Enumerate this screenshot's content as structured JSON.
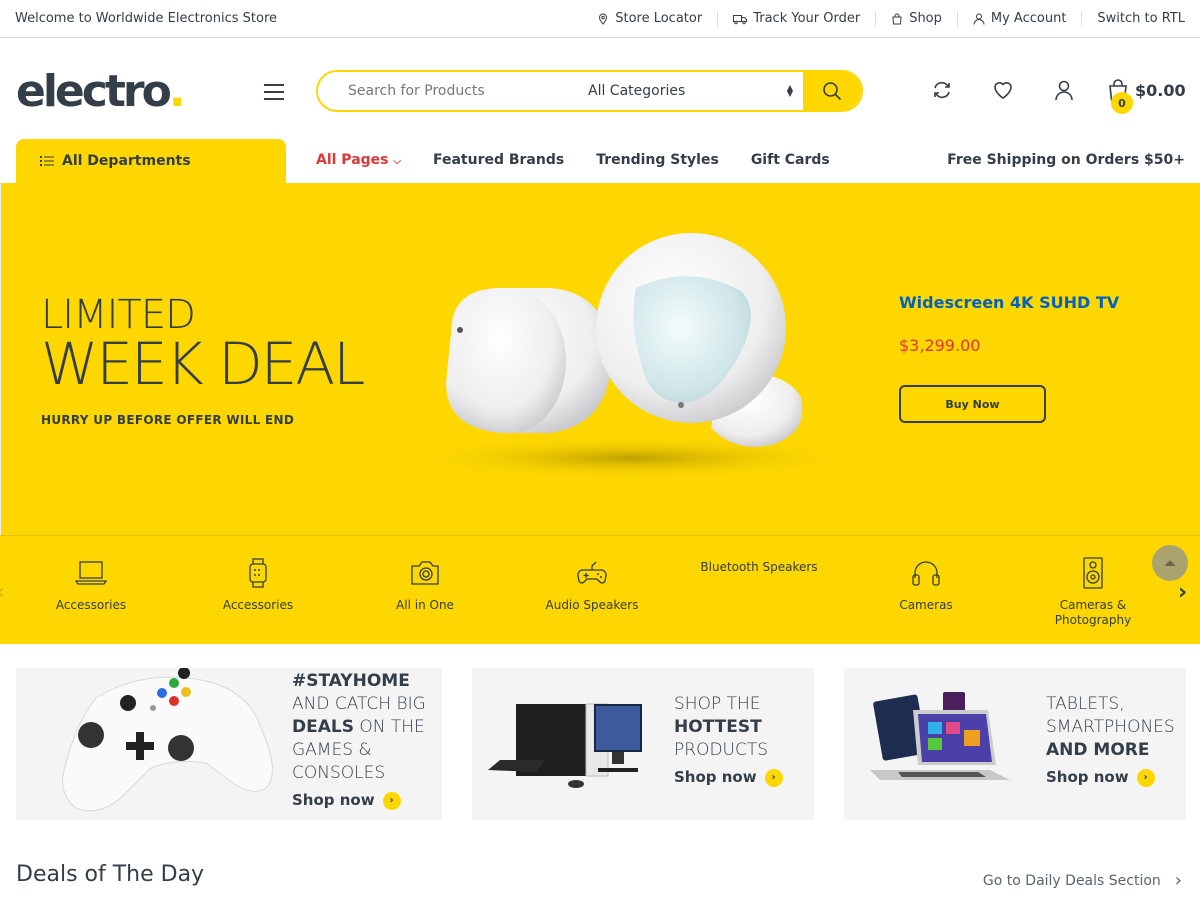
{
  "topbar": {
    "welcome": "Welcome to Worldwide Electronics Store",
    "links": {
      "store_locator": "Store Locator",
      "track_order": "Track Your Order",
      "shop": "Shop",
      "my_account": "My Account",
      "rtl": "Switch to RTL"
    }
  },
  "header": {
    "logo_text": "electro",
    "logo_dot": ".",
    "search_placeholder": "Search for Products",
    "category_selected": "All Categories",
    "cart_count": "0",
    "cart_total": "$0.00"
  },
  "nav": {
    "departments": "All Departments",
    "links": [
      "All Pages",
      "Featured Brands",
      "Trending Styles",
      "Gift Cards"
    ],
    "free_shipping": "Free Shipping on Orders $50+"
  },
  "hero": {
    "line1": "LIMITED",
    "line2": "WEEK DEAL",
    "line3": "HURRY UP BEFORE OFFER WILL END",
    "product_title": "Widescreen 4K SUHD TV",
    "product_price": "$3,299.00",
    "button": "Buy Now"
  },
  "categories": [
    {
      "label": "Accessories",
      "icon": "laptop-icon"
    },
    {
      "label": "Accessories",
      "icon": "smartwatch-icon"
    },
    {
      "label": "All in One",
      "icon": "camera-icon"
    },
    {
      "label": "Audio Speakers",
      "icon": "gamepad-icon"
    },
    {
      "label": "Bluetooth Speakers",
      "icon": ""
    },
    {
      "label": "Cameras",
      "icon": "headphones-icon"
    },
    {
      "label": "Cameras & Photography",
      "icon": "speaker-icon"
    }
  ],
  "banners": [
    {
      "pre": "#STAYHOME",
      "l2": "AND CATCH BIG",
      "l3b": "DEALS",
      "l3": " ON THE",
      "l4": "GAMES &",
      "l5": "CONSOLES",
      "shop": "Shop now"
    },
    {
      "l1": "SHOP THE",
      "l2b": "HOTTEST",
      "l3": "PRODUCTS",
      "shop": "Shop now"
    },
    {
      "l1": "TABLETS,",
      "l2": "SMARTPHONES",
      "l3b": "AND MORE",
      "shop": "Shop now"
    }
  ],
  "deals": {
    "title": "Deals of The Day",
    "link": "Go to Daily Deals Section"
  },
  "colors": {
    "accent": "#fed700",
    "text": "#333e48",
    "sale": "#df3737",
    "link": "#0062bd"
  }
}
